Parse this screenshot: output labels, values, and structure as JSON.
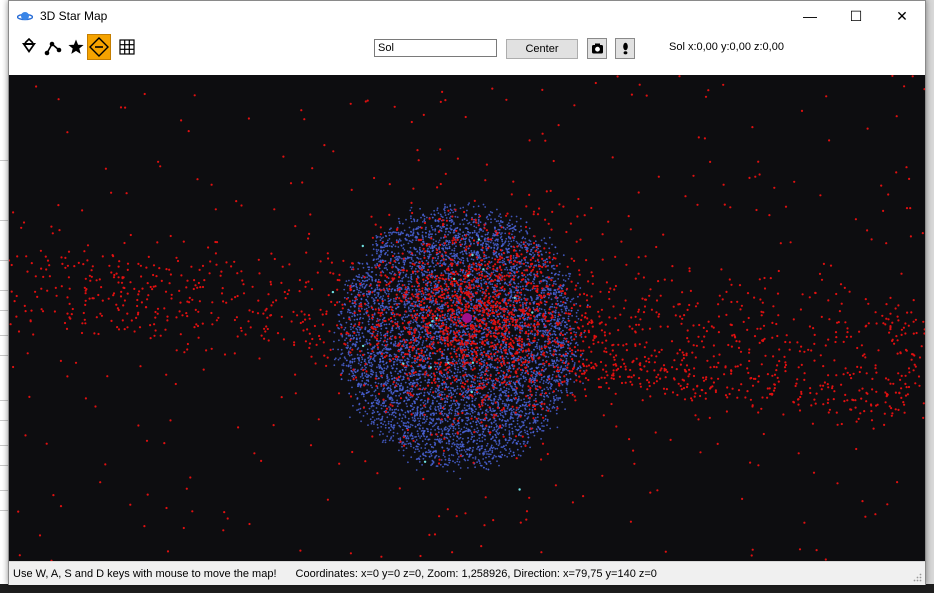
{
  "window": {
    "title": "3D Star Map",
    "controls": {
      "minimize": "—",
      "maximize": "☐",
      "close": "✕"
    }
  },
  "toolbar": {
    "tools": [
      {
        "name": "filter-icon",
        "active": false
      },
      {
        "name": "route-icon",
        "active": false
      },
      {
        "name": "star-icon",
        "active": false
      },
      {
        "name": "zoom-out-icon",
        "active": true
      },
      {
        "name": "grid-icon",
        "active": false
      }
    ],
    "search_value": "Sol",
    "center_label": "Center",
    "current_system": "Sol x:0,00 y:0,00 z:0,00"
  },
  "status": {
    "help": "Use W, A, S and D keys with mouse to move the map!",
    "coords": "Coordinates: x=0 y=0 z=0, Zoom: 1,258926, Direction: x=79,75 y=140 z=0"
  },
  "colors": {
    "map_background": "#0d0d10",
    "red_stars": "#e01010",
    "blue_stars": "#4a63d6",
    "active_tool": "#f5a300"
  }
}
